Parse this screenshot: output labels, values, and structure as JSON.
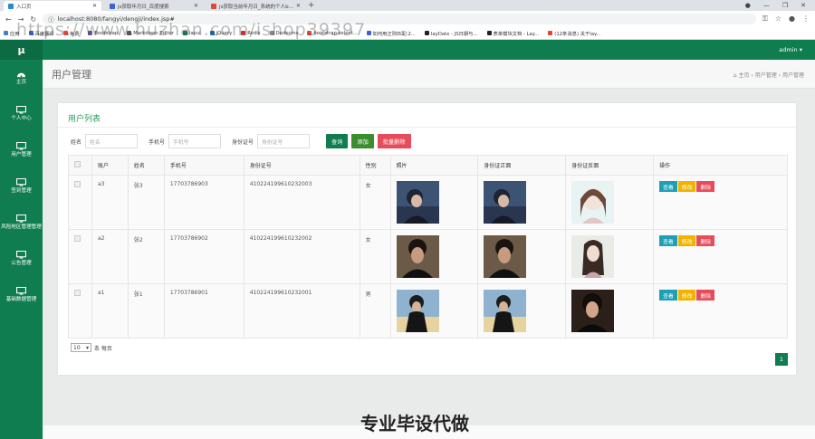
{
  "browser": {
    "tabs": [
      {
        "title": "入口页",
        "active": true
      },
      {
        "title": "js获取年月日_百度搜索",
        "active": false
      },
      {
        "title": "js获取当前年月日_系统的个人b...",
        "active": false
      }
    ],
    "url": "localhost:8080/fangyi/dengji/index.jsp#",
    "bookmarks": [
      "应用",
      "百度翻译",
      "免费",
      "Bootstrap",
      "Markdown Editor",
      "layui",
      "jQuery",
      "Redis",
      "Dedecms",
      "bootstrap-select...",
      "如何用正则匹配:2...",
      "layDate - JS日期与...",
      "表单模块文档 - Lay...",
      "(12条消息) 关于lay..."
    ]
  },
  "sidebar": {
    "logo": "μ",
    "items": [
      {
        "label": "主页",
        "icon": "dashboard-icon"
      },
      {
        "label": "个人中心",
        "icon": "monitor-icon"
      },
      {
        "label": "用户管理",
        "icon": "monitor-icon"
      },
      {
        "label": "签到管理",
        "icon": "monitor-icon"
      },
      {
        "label": "风险地区管理管理",
        "icon": "monitor-icon"
      },
      {
        "label": "公告管理",
        "icon": "monitor-icon"
      },
      {
        "label": "基础数据管理",
        "icon": "monitor-icon"
      }
    ]
  },
  "topbar": {
    "user": "admin ▾"
  },
  "page": {
    "title": "用户管理",
    "breadcrumb": [
      "主页",
      "用户管理",
      "用户管理"
    ]
  },
  "card": {
    "title": "用户列表",
    "filters": [
      {
        "label": "姓名",
        "placeholder": "姓名"
      },
      {
        "label": "手机号",
        "placeholder": "手机号"
      },
      {
        "label": "身份证号",
        "placeholder": "身份证号"
      }
    ],
    "buttons": {
      "search": "查询",
      "add": "添加",
      "batch_delete": "批量删除"
    }
  },
  "table": {
    "headers": [
      "",
      "账户",
      "姓名",
      "手机号",
      "身份证号",
      "性别",
      "照片",
      "身份证正面",
      "身份证反面",
      "操作"
    ],
    "rows": [
      {
        "account": "a3",
        "name": "张3",
        "phone": "17703786903",
        "id_card": "410224199610232003",
        "gender": "女"
      },
      {
        "account": "a2",
        "name": "张2",
        "phone": "17703786902",
        "id_card": "410224199610232002",
        "gender": "女"
      },
      {
        "account": "a1",
        "name": "张1",
        "phone": "17703786901",
        "id_card": "410224199610232001",
        "gender": "男"
      }
    ],
    "actions": {
      "view": "查看",
      "edit": "修改",
      "delete": "删除"
    }
  },
  "pagination": {
    "page_size": "10",
    "per_page_label": "条 每页",
    "current_page": "1"
  },
  "watermarks": {
    "top": "https://www.huzhan.com/ishop39397",
    "bottom": "专业毕设代做"
  },
  "colors": {
    "primary": "#0f7d4f",
    "danger": "#e74c5b",
    "warning": "#f0b400",
    "info": "#1f9fb5"
  }
}
